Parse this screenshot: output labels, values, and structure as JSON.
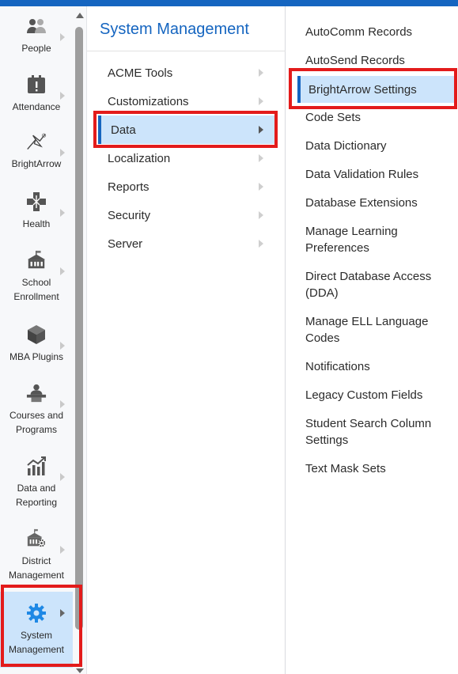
{
  "rail": {
    "items": [
      {
        "label": "People",
        "icon": "people-icon"
      },
      {
        "label": "Attendance",
        "icon": "attendance-icon"
      },
      {
        "label": "BrightArrow",
        "icon": "brightarrow-icon"
      },
      {
        "label": "Health",
        "icon": "health-icon"
      },
      {
        "label": "School Enrollment",
        "icon": "school-icon"
      },
      {
        "label": "MBA Plugins",
        "icon": "plugin-cube-icon"
      },
      {
        "label": "Courses and Programs",
        "icon": "courses-icon"
      },
      {
        "label": "Data and Reporting",
        "icon": "chart-icon"
      },
      {
        "label": "District Management",
        "icon": "district-icon"
      },
      {
        "label": "System Management",
        "icon": "gear-icon",
        "active": true
      }
    ]
  },
  "middle": {
    "title": "System Management",
    "items": [
      {
        "label": "ACME Tools"
      },
      {
        "label": "Customizations"
      },
      {
        "label": "Data",
        "active": true
      },
      {
        "label": "Localization"
      },
      {
        "label": "Reports"
      },
      {
        "label": "Security"
      },
      {
        "label": "Server"
      }
    ]
  },
  "right": {
    "items": [
      {
        "label": "AutoComm Records"
      },
      {
        "label": "AutoSend Records"
      },
      {
        "label": "BrightArrow Settings",
        "active": true
      },
      {
        "label": "Code Sets"
      },
      {
        "label": "Data Dictionary"
      },
      {
        "label": "Data Validation Rules"
      },
      {
        "label": "Database Extensions"
      },
      {
        "label": "Manage Learning Preferences"
      },
      {
        "label": "Direct Database Access (DDA)"
      },
      {
        "label": "Manage ELL Language Codes"
      },
      {
        "label": "Notifications"
      },
      {
        "label": "Legacy Custom Fields"
      },
      {
        "label": "Student Search Column Settings"
      },
      {
        "label": "Text Mask Sets"
      }
    ]
  },
  "colors": {
    "accent": "#1565c0",
    "active_bg": "#cce4fb",
    "highlight": "#e31b1b"
  }
}
